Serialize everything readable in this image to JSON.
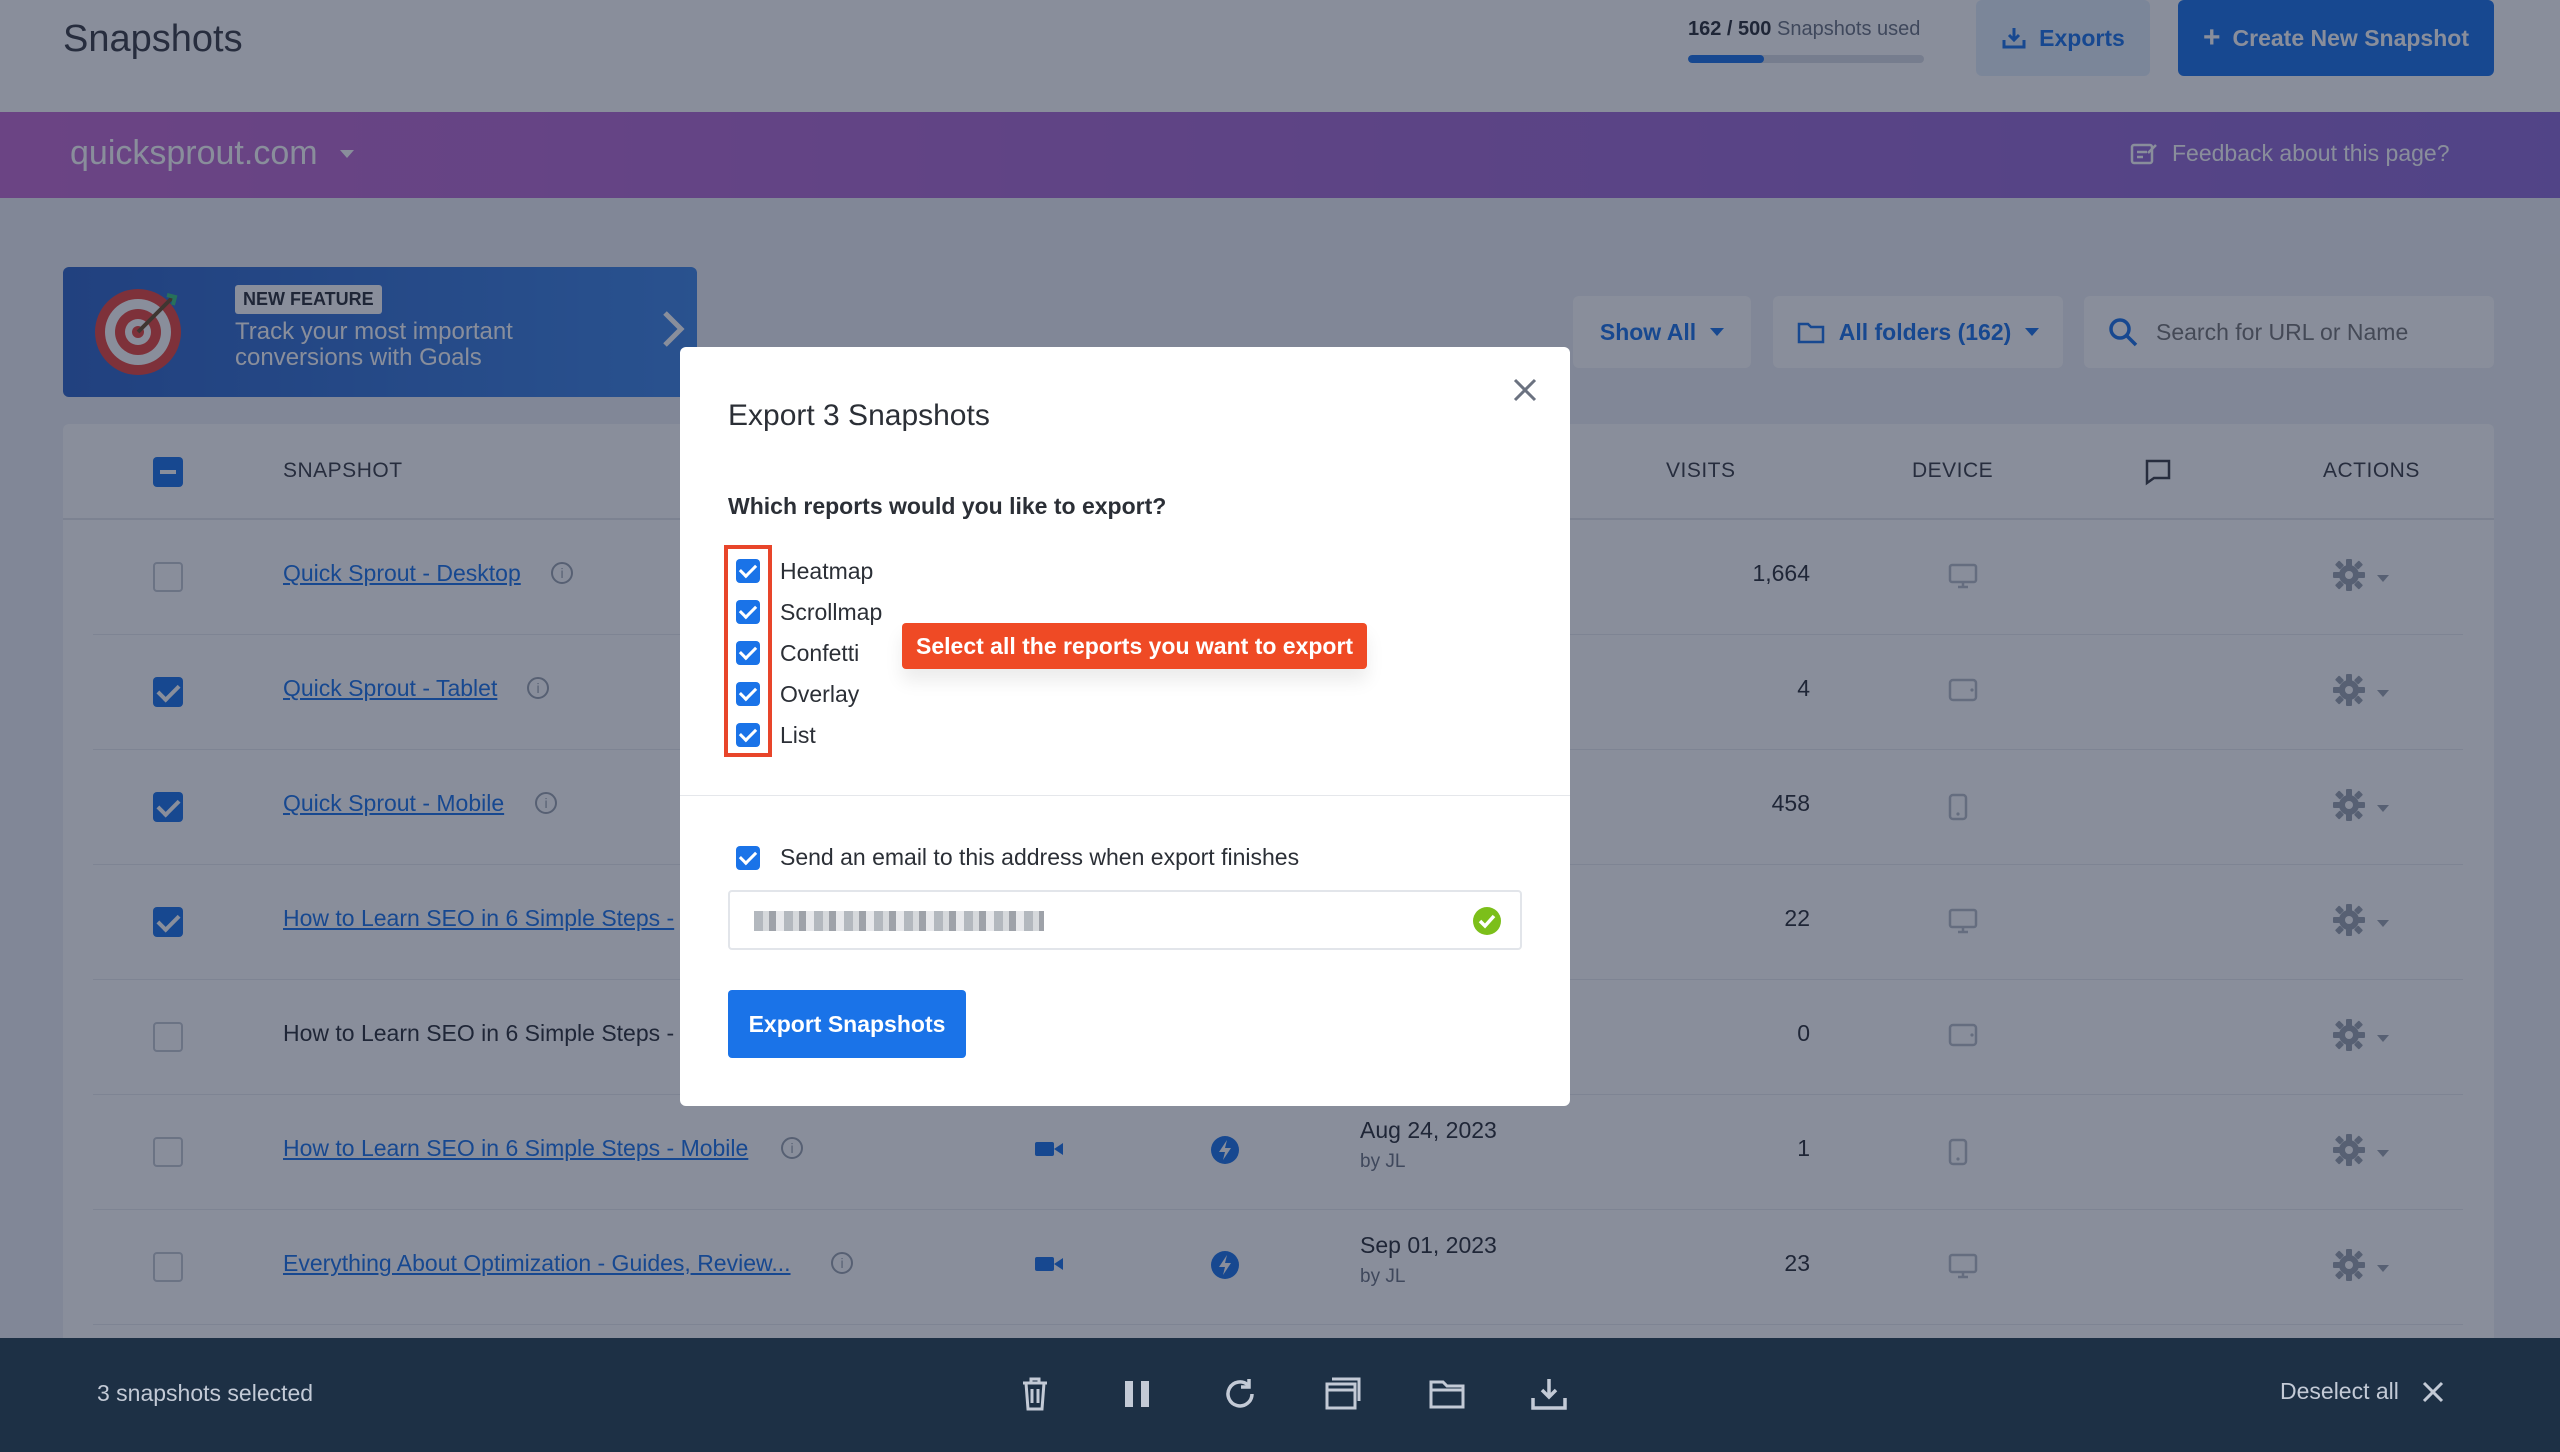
{
  "header": {
    "title": "Snapshots",
    "usage_used": "162",
    "usage_sep": " / ",
    "usage_total": "500",
    "usage_suffix": " Snapshots used",
    "usage_fraction": 0.324,
    "exports_label": "Exports",
    "create_label": "Create New Snapshot"
  },
  "site": {
    "name": "quicksprout.com",
    "feedback_label": "Feedback about this page?"
  },
  "banner": {
    "badge": "NEW FEATURE",
    "text": "Track your most important conversions with Goals"
  },
  "filters": {
    "show_all": "Show All",
    "folders": "All folders (162)",
    "search_placeholder": "Search for URL or Name"
  },
  "table": {
    "columns": {
      "snapshot": "SNAPSHOT",
      "visits": "VISITS",
      "device": "DEVICE",
      "actions": "ACTIONS"
    },
    "rows": [
      {
        "name": "Quick Sprout - Desktop",
        "linked": true,
        "checked": false,
        "visits": "1,664",
        "device": "desktop-icon",
        "date": "",
        "by": ""
      },
      {
        "name": "Quick Sprout - Tablet",
        "linked": true,
        "checked": true,
        "visits": "4",
        "device": "tablet-icon",
        "date": "",
        "by": ""
      },
      {
        "name": "Quick Sprout - Mobile",
        "linked": true,
        "checked": true,
        "visits": "458",
        "device": "mobile-icon",
        "date": "",
        "by": ""
      },
      {
        "name": "How to Learn SEO in 6 Simple Steps -",
        "linked": true,
        "checked": true,
        "visits": "22",
        "device": "desktop-icon",
        "date": "",
        "by": ""
      },
      {
        "name": "How to Learn SEO in 6 Simple Steps -",
        "linked": false,
        "checked": false,
        "visits": "0",
        "device": "tablet-icon",
        "date": "",
        "by": ""
      },
      {
        "name": "How to Learn SEO in 6 Simple Steps - Mobile",
        "linked": true,
        "checked": false,
        "visits": "1",
        "device": "mobile-icon",
        "date": "Aug 24, 2023",
        "by": "by JL"
      },
      {
        "name": "Everything About Optimization - Guides, Review...",
        "linked": true,
        "checked": false,
        "visits": "23",
        "device": "desktop-icon",
        "date": "Sep 01, 2023",
        "by": "by JL"
      }
    ]
  },
  "bottom_bar": {
    "selected": "3 snapshots selected",
    "deselect": "Deselect all"
  },
  "modal": {
    "title": "Export 3 Snapshots",
    "question": "Which reports would you like to export?",
    "reports": [
      "Heatmap",
      "Scrollmap",
      "Confetti",
      "Overlay",
      "List"
    ],
    "tooltip": "Select all the reports you want to export",
    "email_label": "Send an email to this address when export finishes",
    "export_button": "Export Snapshots"
  },
  "colors": {
    "primary": "#1a73e8",
    "highlight": "#e8452a",
    "tooltip": "#ef4a25",
    "valid": "#7cbf1a"
  }
}
